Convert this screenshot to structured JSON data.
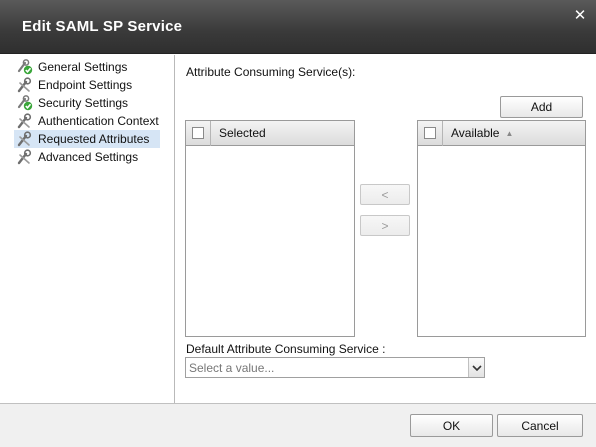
{
  "window": {
    "title": "Edit SAML SP Service"
  },
  "sidebar": {
    "items": [
      {
        "label": "General Settings",
        "icon": "check-tool-icon"
      },
      {
        "label": "Endpoint Settings",
        "icon": "tool-icon"
      },
      {
        "label": "Security Settings",
        "icon": "check-tool-icon"
      },
      {
        "label": "Authentication Context",
        "icon": "tool-icon"
      },
      {
        "label": "Requested Attributes",
        "icon": "tool-icon",
        "selected": true
      },
      {
        "label": "Advanced Settings",
        "icon": "tool-icon"
      }
    ]
  },
  "main": {
    "section_label": "Attribute Consuming Service(s):",
    "add_button": "Add",
    "selected_list": {
      "header": "Selected"
    },
    "available_list": {
      "header": "Available"
    },
    "move_left_button": "<",
    "move_right_button": ">",
    "default_service": {
      "label": "Default Attribute Consuming Service :",
      "placeholder": "Select a value..."
    }
  },
  "footer": {
    "ok_button": "OK",
    "cancel_button": "Cancel"
  },
  "colors": {
    "titlebar": "#3a3a3a",
    "selection": "#d6e5f5",
    "check_green": "#3aa63a"
  }
}
